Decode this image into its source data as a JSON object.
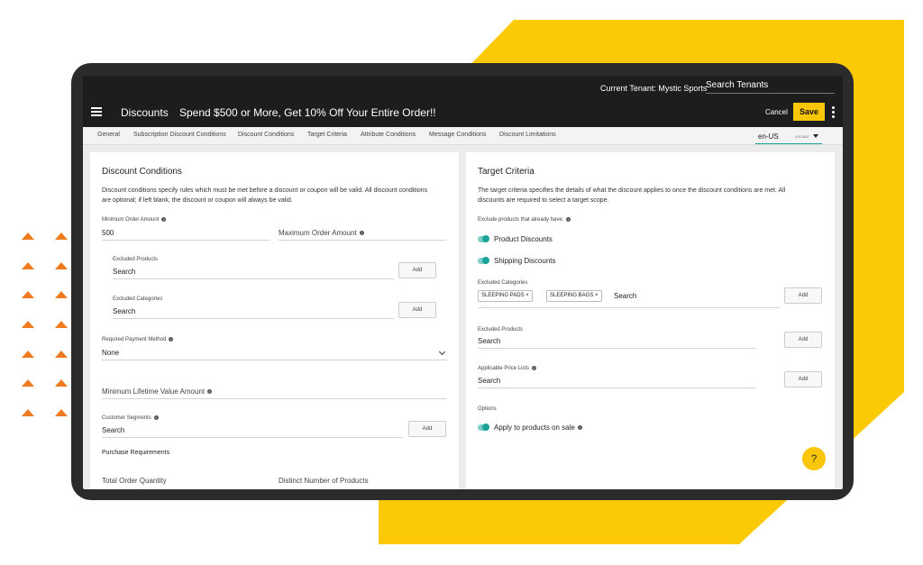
{
  "topbar": {
    "tenant_label": "Current Tenant: Mystic Sports",
    "tenant_search": "Search Tenants"
  },
  "appbar": {
    "section": "Discounts",
    "page_title": "Spend $500 or More, Get 10% Off Your Entire Order!!",
    "cancel": "Cancel",
    "save": "Save"
  },
  "tabs": [
    "General",
    "Subscription Discount Conditions",
    "Discount Conditions",
    "Target Criteria",
    "Attribute Conditions",
    "Message Conditions",
    "Discount Limitations"
  ],
  "locale": {
    "value": "en-US",
    "label": "LOCALE"
  },
  "left": {
    "title": "Discount Conditions",
    "desc1": "Discount conditions specify rules which must be met before a discount or coupon will be valid. All discount conditions",
    "desc2": "are optional; if left blank, the discount or coupon will always be valid.",
    "min_order_label": "Minimum Order Amount",
    "min_order_value": "500",
    "max_order_label": "Maximum Order Amount",
    "excluded_products_label": "Excluded Products",
    "excluded_products_placeholder": "Search",
    "excluded_categories_label": "Excluded Categories",
    "excluded_categories_placeholder": "Search",
    "add": "Add",
    "payment_label": "Required Payment Method",
    "payment_value": "None",
    "lifetime_label": "Minimum Lifetime Value Amount",
    "segments_label": "Customer Segments",
    "segments_placeholder": "Search",
    "purchase_req": "Purchase Requirements",
    "total_qty": "Total Order Quantity",
    "distinct_num": "Distinct Number of Products"
  },
  "right": {
    "title": "Target Criteria",
    "desc1": "The target criteria specifies the details of what the discount applies to once the discount conditions are met. All",
    "desc2": "discounts are required to select a target scope.",
    "exclude_label": "Exclude products that already have:",
    "toggle1": "Product Discounts",
    "toggle2": "Shipping Discounts",
    "excl_cat_label": "Excluded Categories",
    "chips": [
      "SLEEPING PADS ×",
      "SLEEPING BAGS ×"
    ],
    "excl_cat_placeholder": "Search",
    "excl_prod_label": "Excluded Products",
    "excl_prod_placeholder": "Search",
    "price_lists_label": "Applicable Price Lists",
    "price_lists_placeholder": "Search",
    "add": "Add",
    "options_label": "Options",
    "toggle3": "Apply to products on sale"
  },
  "help": "?",
  "colors": {
    "accent_yellow": "#f9c609",
    "teal": "#1aa39a",
    "orange": "#f07a1e"
  }
}
